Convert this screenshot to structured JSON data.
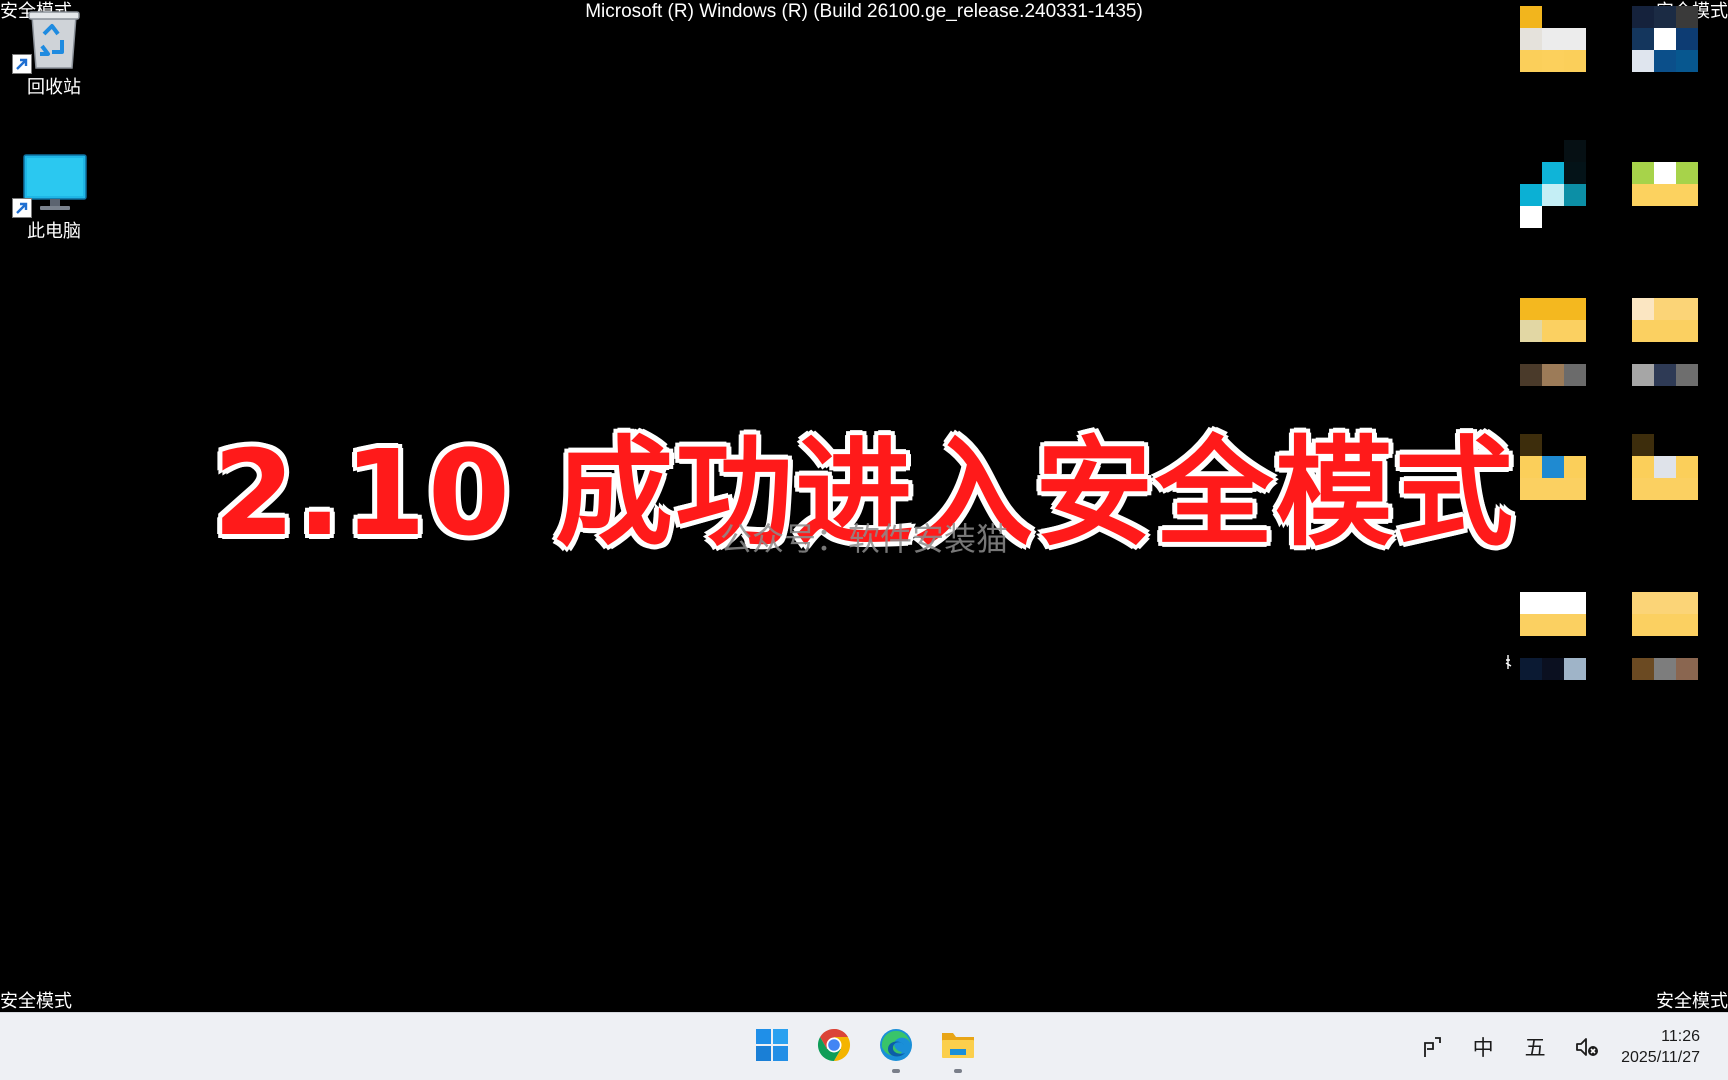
{
  "window": {
    "build_title": "Microsoft (R) Windows (R) (Build 26100.ge_release.240331-1435)",
    "corner_labels": {
      "top_left": "安全模式",
      "top_right": "安全模式",
      "bottom_left": "安全模式",
      "bottom_right": "安全模式"
    }
  },
  "desktop": {
    "icons": [
      {
        "name": "recycle-bin",
        "label": "回收站"
      },
      {
        "name": "this-pc",
        "label": "此电脑"
      }
    ]
  },
  "overlay": {
    "headline": "2.10 成功进入安全模式",
    "headline_color": "#ff1a1a",
    "watermark": "公众号：软件安装猫"
  },
  "taskbar": {
    "apps": [
      {
        "name": "start",
        "icon": "windows-logo-icon"
      },
      {
        "name": "chrome",
        "icon": "chrome-icon"
      },
      {
        "name": "edge",
        "icon": "edge-icon",
        "running": true
      },
      {
        "name": "file-explorer",
        "icon": "folder-icon",
        "running": true
      }
    ],
    "tray": {
      "input_icon": "pen-input-icon",
      "ime_lang": "中",
      "ime_mode": "五",
      "volume_icon": "speaker-muted-icon"
    },
    "clock": {
      "time": "11:26",
      "date": "2025/11/27"
    }
  },
  "colors": {
    "desktop_bg": "#000000",
    "taskbar_bg": "#eef0f4",
    "accent": "#0078d4"
  }
}
